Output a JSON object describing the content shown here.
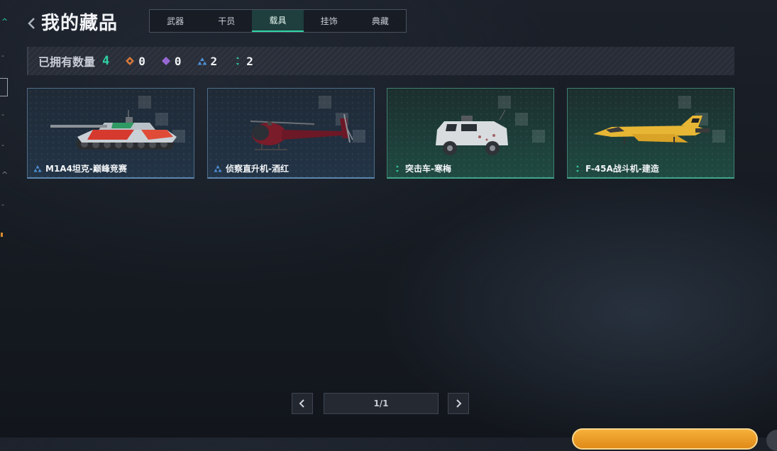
{
  "header": {
    "title": "我的藏品"
  },
  "tabs": [
    {
      "label": "武器",
      "active": false
    },
    {
      "label": "干员",
      "active": false
    },
    {
      "label": "载具",
      "active": true
    },
    {
      "label": "挂饰",
      "active": false
    },
    {
      "label": "典藏",
      "active": false
    }
  ],
  "owned": {
    "label": "已拥有数量",
    "total": "4",
    "rarity_counts": [
      {
        "icon": "orange-diamond-cluster-icon",
        "color": "#d9793a",
        "count": "0"
      },
      {
        "icon": "purple-diamond-cluster-icon",
        "color": "#9a6ad8",
        "count": "0"
      },
      {
        "icon": "blue-triangle-cluster-icon",
        "color": "#4f8fd4",
        "count": "2"
      },
      {
        "icon": "green-dots-icon",
        "color": "#2fc79b",
        "count": "2"
      }
    ]
  },
  "items": [
    {
      "name": "M1A4坦克-巅峰竞赛",
      "rarity": "blue",
      "icon": "tank-image"
    },
    {
      "name": "侦察直升机-酒红",
      "rarity": "blue",
      "icon": "helicopter-image"
    },
    {
      "name": "突击车-寒梅",
      "rarity": "green",
      "icon": "armored-car-image"
    },
    {
      "name": "F-45A战斗机-建造",
      "rarity": "green",
      "icon": "fighter-jet-image"
    }
  ],
  "pagination": {
    "value": "1/1"
  },
  "colors": {
    "accent": "#2fd3a4",
    "blue_rarity": "#4f8fd4",
    "green_rarity": "#2fc79b"
  }
}
